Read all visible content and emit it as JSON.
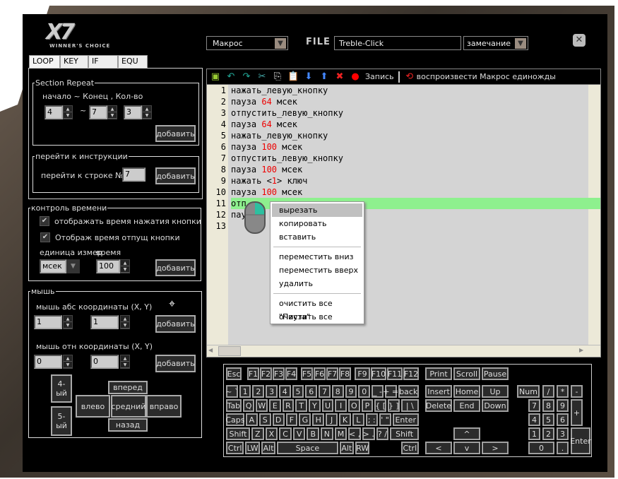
{
  "logo": {
    "text": "X7",
    "subtitle": "WINNER'S CHOICE"
  },
  "header": {
    "mode": "Макрос",
    "file_label": "FILE",
    "file_name": "Treble-Click",
    "remark": "замечание"
  },
  "tabs": [
    "LOOP",
    "KEY",
    "IF",
    "EQU"
  ],
  "loop": {
    "section_repeat": {
      "title": "Section Repeat",
      "label": "начало ~ Конец , Кол-во",
      "start": "4",
      "tilde": "~",
      "end": "7",
      "count": "3",
      "add": "добавить"
    },
    "goto": {
      "title": "перейти к инструкции",
      "label": "перейти к строке №:",
      "line": "7",
      "add": "добавить"
    }
  },
  "time_control": {
    "title": "контроль времени",
    "show_press": "отображать время нажатия кнопки",
    "show_release": "Отображ время отпущ кнопки",
    "unit_label": "единица измер",
    "time_label": "время",
    "unit": "мсек",
    "time": "100",
    "add": "добавить",
    "show_press_checked": true,
    "show_release_checked": true
  },
  "mouse": {
    "title": "мышь",
    "abs_label": "мышь абс координаты (X, Y)",
    "abs_x": "1",
    "abs_y": "1",
    "rel_label": "мышь отн координаты (X, Y)",
    "rel_x": "0",
    "rel_y": "0",
    "add": "добавить",
    "buttons": {
      "b4": "4-ый",
      "b5": "5-ый",
      "forward": "вперед",
      "left": "влево",
      "middle": "средний",
      "right": "вправо",
      "back": "назад"
    }
  },
  "toolbar": {
    "record": "Запись",
    "play_once": "воспроизвести Макрос единожды"
  },
  "editor": {
    "lines": [
      [
        [
          "нажать_левую_кнопку",
          0
        ]
      ],
      [
        [
          "пауза ",
          0
        ],
        [
          "64",
          1
        ],
        [
          " мсек",
          0
        ]
      ],
      [
        [
          "отпустить_левую_кнопку",
          0
        ]
      ],
      [
        [
          "пауза ",
          0
        ],
        [
          "64",
          1
        ],
        [
          " мсек",
          0
        ]
      ],
      [
        [
          "нажать_левую_кнопку",
          0
        ]
      ],
      [
        [
          "пауза ",
          0
        ],
        [
          "100",
          1
        ],
        [
          " мсек",
          0
        ]
      ],
      [
        [
          "отпустить_левую_кнопку",
          0
        ]
      ],
      [
        [
          "пауза ",
          0
        ],
        [
          "100",
          1
        ],
        [
          " мсек",
          0
        ]
      ],
      [
        [
          "нажать <",
          0
        ],
        [
          "1",
          1
        ],
        [
          "> ключ",
          0
        ]
      ],
      [
        [
          "пауза ",
          0
        ],
        [
          "100",
          1
        ],
        [
          " мсек",
          0
        ]
      ],
      [
        [
          "отп",
          0
        ]
      ],
      [
        [
          "пау",
          0
        ]
      ],
      []
    ],
    "highlighted_line": 11
  },
  "context_menu": {
    "items": [
      [
        "вырезать",
        "копировать",
        "вставить"
      ],
      [
        "переместить вниз",
        "переместить вверх",
        "удалить"
      ],
      [
        "очистить все \"Пауза\"",
        "очистить все"
      ]
    ],
    "selected": "вырезать"
  },
  "keyboard": {
    "esc": "Esc",
    "f1_4": [
      "F1",
      "F2",
      "F3",
      "F4"
    ],
    "f5_8": [
      "F5",
      "F6",
      "F7",
      "F8"
    ],
    "f9_12": [
      "F9",
      "F10",
      "F11",
      "F12"
    ],
    "rows": [
      [
        "~ `",
        "1",
        "2",
        "3",
        "4",
        "5",
        "6",
        "7",
        "8",
        "9",
        "0",
        "_ -",
        "+ =",
        "back"
      ],
      [
        "Tab",
        "Q",
        "W",
        "E",
        "R",
        "T",
        "Y",
        "U",
        "I",
        "O",
        "P",
        "{ [",
        "} ]",
        "| \\"
      ],
      [
        "Caps",
        "A",
        "S",
        "D",
        "F",
        "G",
        "H",
        "J",
        "K",
        "L",
        "; :",
        "' \"",
        "Enter"
      ],
      [
        "Shift",
        "Z",
        "X",
        "C",
        "V",
        "B",
        "N",
        "M",
        "< ,",
        "> .",
        "? /",
        "Shift"
      ],
      [
        "Ctrl",
        "LW",
        "Alt",
        "Space",
        "Alt",
        "RW",
        "",
        "Ctrl"
      ]
    ],
    "sys": [
      "Print",
      "Scroll",
      "Pause"
    ],
    "nav1": [
      "Insert",
      "Home",
      "Up"
    ],
    "nav2": [
      "Delete",
      "End",
      "Down"
    ],
    "arrows": {
      "up": "^",
      "left": "<",
      "down": "v",
      "right": ">"
    },
    "numpad": {
      "num": "Num",
      "div": "/",
      "mul": "*",
      "sub": "-",
      "n7": "7",
      "n8": "8",
      "n9": "9",
      "add": "+",
      "n4": "4",
      "n5": "5",
      "n6": "6",
      "n1": "1",
      "n2": "2",
      "n3": "3",
      "enter": "Enter",
      "n0": "0",
      "dot": "."
    }
  }
}
